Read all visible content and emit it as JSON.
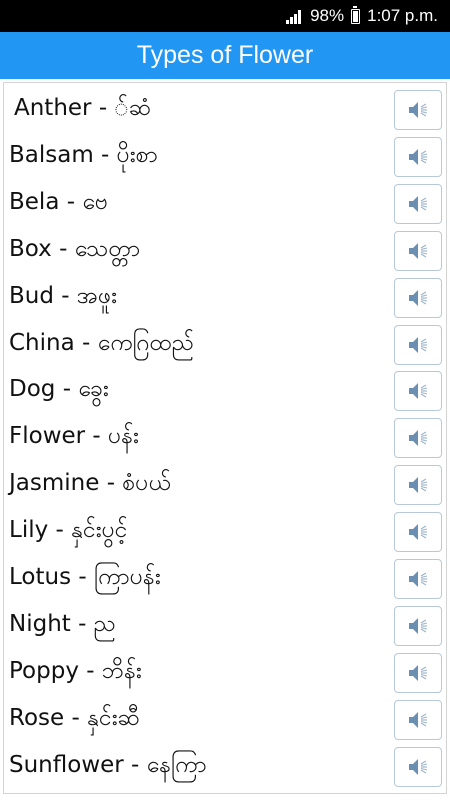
{
  "status_bar": {
    "battery": "98%",
    "time": "1:07 p.m."
  },
  "app": {
    "title": "Types of Flower"
  },
  "accent_color": "#2196F3",
  "items": [
    {
      "label": "Anther - ်ဆံ",
      "icon": "speaker-icon"
    },
    {
      "label": "Balsam - ပိုးစာ",
      "icon": "speaker-icon"
    },
    {
      "label": "Bela - ဗေ",
      "icon": "speaker-icon"
    },
    {
      "label": "Box - သေတ္တာ",
      "icon": "speaker-icon"
    },
    {
      "label": "Bud - အဖူး",
      "icon": "speaker-icon"
    },
    {
      "label": "China - ကေဂြထည်",
      "icon": "speaker-icon"
    },
    {
      "label": "Dog - ခွေး",
      "icon": "speaker-icon"
    },
    {
      "label": "Flower - ပန်း",
      "icon": "speaker-icon"
    },
    {
      "label": "Jasmine - စံပယ်",
      "icon": "speaker-icon"
    },
    {
      "label": "Lily - နှင်းပွင့်",
      "icon": "speaker-icon"
    },
    {
      "label": "Lotus - ကြာပန်း",
      "icon": "speaker-icon"
    },
    {
      "label": "Night - ည",
      "icon": "speaker-icon"
    },
    {
      "label": "Poppy - ဘိန်း",
      "icon": "speaker-icon"
    },
    {
      "label": "Rose - နှင်းဆီ",
      "icon": "speaker-icon"
    },
    {
      "label": "Sunflower - နေကြာ",
      "icon": "speaker-icon"
    }
  ]
}
